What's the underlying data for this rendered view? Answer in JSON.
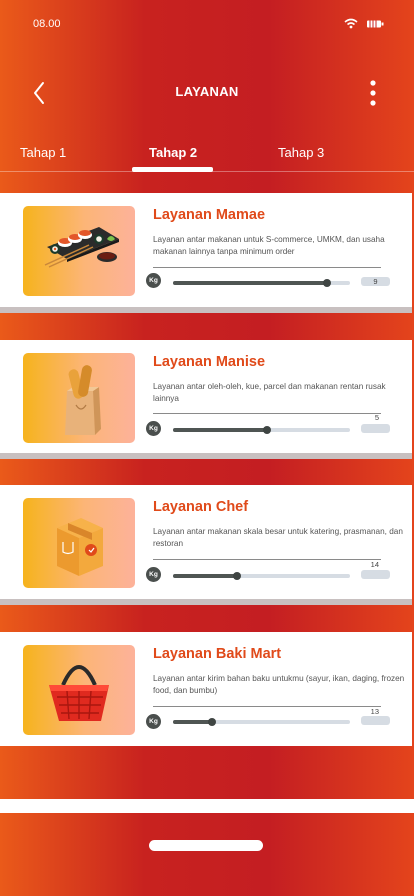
{
  "status": {
    "time": "08.00",
    "wifi_icon": "wifi-icon",
    "battery_icon": "battery-icon"
  },
  "header": {
    "title": "LAYANAN",
    "back_icon": "chevron-left-icon",
    "menu_icon": "more-vertical-icon"
  },
  "tabs": [
    {
      "label": "Tahap 1",
      "active": false
    },
    {
      "label": "Tahap 2",
      "active": true
    },
    {
      "label": "Tahap 3",
      "active": false
    }
  ],
  "services": [
    {
      "name": "Layanan Mamae",
      "description": "Layanan antar makanan untuk S-commerce, UMKM, dan usaha makanan lainnya tanpa minimum order",
      "unit": "Kg",
      "weight": "9",
      "slider_fraction": 0.87,
      "illustration": "sushi-platter-icon"
    },
    {
      "name": "Layanan Manise",
      "description": "Layanan antar oleh-oleh, kue, parcel dan makanan rentan rusak lainnya",
      "unit": "Kg",
      "weight": "5",
      "slider_fraction": 0.53,
      "illustration": "bread-bag-icon"
    },
    {
      "name": "Layanan Chef",
      "description": "Layanan antar makanan skala besar untuk katering, prasmanan, dan restoran",
      "unit": "Kg",
      "weight": "14",
      "slider_fraction": 0.36,
      "illustration": "delivery-box-icon"
    },
    {
      "name": "Layanan Baki Mart",
      "description": "Layanan antar kirim bahan baku untukmu (sayur, ikan, daging, frozen food, dan bumbu)",
      "unit": "Kg",
      "weight": "13",
      "slider_fraction": 0.22,
      "illustration": "shopping-basket-icon"
    }
  ],
  "colors": {
    "accent": "#e04a1a",
    "header_red": "#c8221f",
    "header_orange": "#ea5a1a",
    "slider_dark": "#4f5553",
    "slider_track": "#d6dce3"
  }
}
